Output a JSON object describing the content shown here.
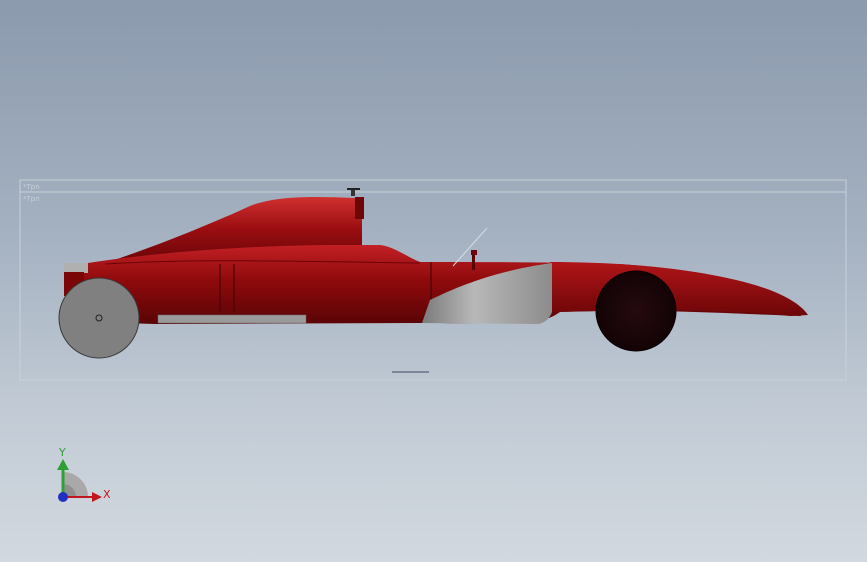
{
  "viewport": {
    "background_top": "#8b9aad",
    "background_bottom": "#d2d8df"
  },
  "model": {
    "body_color": "#8e0a0c",
    "sidepod_panel_color": "#9a9a9a",
    "rear_wheel_color": "#808080",
    "front_wheel_color": "#1a0508"
  },
  "sketch_labels": {
    "upper": "*Tpn",
    "lower": "*Tpn"
  },
  "triad": {
    "x_label": "X",
    "y_label": "Y",
    "x_color": "#c0161e",
    "y_color": "#2fa033",
    "z_color": "#2030c0"
  }
}
